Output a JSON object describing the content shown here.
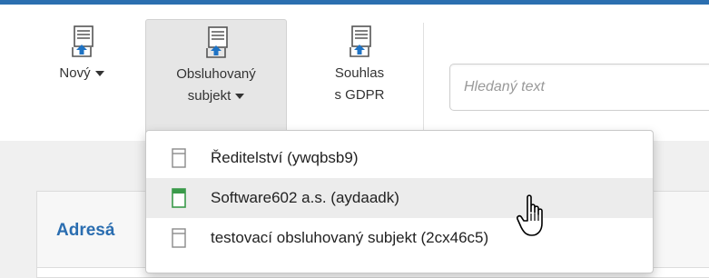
{
  "toolbar": {
    "buttons": [
      {
        "label_line1": "Nový",
        "label_line2": "",
        "has_caret": true,
        "icon": "document-upload-icon"
      },
      {
        "label_line1": "Obsluhovaný",
        "label_line2": "subjekt",
        "has_caret": true,
        "active": true,
        "icon": "document-upload-icon"
      },
      {
        "label_line1": "Souhlas",
        "label_line2": "s GDPR",
        "has_caret": false,
        "icon": "document-upload-icon"
      }
    ]
  },
  "search": {
    "placeholder": "Hledaný text",
    "value": ""
  },
  "panel": {
    "title": "Adresá"
  },
  "dropdown": {
    "items": [
      {
        "label": "Ředitelství (ywqbsb9)",
        "icon": "document-icon",
        "icon_color": "#8a8a8a",
        "selected": false
      },
      {
        "label": "Software602 a.s. (aydaadk)",
        "icon": "document-icon",
        "icon_color": "#3a9a4a",
        "selected": true
      },
      {
        "label": "testovací obsluhovaný subjekt (2cx46c5)",
        "icon": "document-icon",
        "icon_color": "#8a8a8a",
        "selected": false
      }
    ]
  },
  "colors": {
    "accent": "#2a6db0",
    "selected_icon": "#3a9a4a",
    "icon_gray": "#8a8a8a",
    "upload_arrow": "#1f73c4"
  },
  "cursor": {
    "icon": "hand-pointer-icon"
  }
}
